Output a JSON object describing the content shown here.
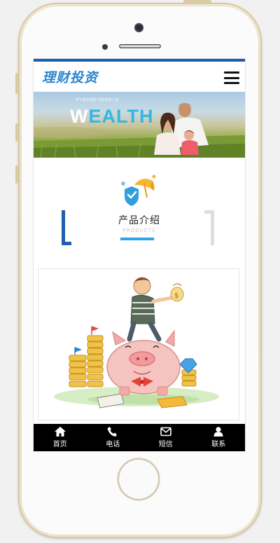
{
  "header": {
    "logo_text": "理财投资",
    "menu_icon": "hamburger-menu-icon"
  },
  "banner": {
    "small_text": "学习投资理财 创造财富人生",
    "word_prefix": "W",
    "word_accent": "EALTH"
  },
  "section": {
    "title": "产品介绍",
    "subtitle": "PRODUCTS",
    "icon": "umbrella-shield-icon"
  },
  "product": {
    "image": "piggy-bank-illustration"
  },
  "bottom_nav": [
    {
      "label": "首页",
      "icon": "home-icon"
    },
    {
      "label": "电话",
      "icon": "phone-icon"
    },
    {
      "label": "短信",
      "icon": "envelope-icon"
    },
    {
      "label": "联系",
      "icon": "user-icon"
    }
  ],
  "colors": {
    "brand_blue": "#1e5fae",
    "accent_blue": "#2aa8e6",
    "nav_background": "#000000"
  }
}
